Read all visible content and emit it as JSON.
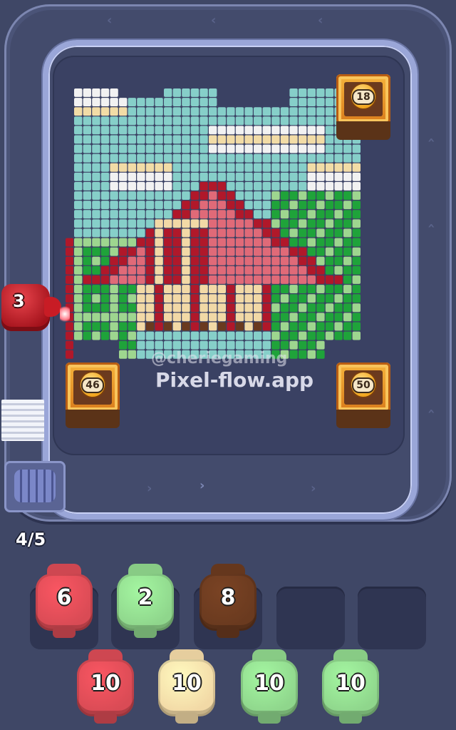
{
  "watermark": {
    "handle": "@cheriegaming",
    "site": "Pixel-flow.app"
  },
  "shooter": {
    "count": "3",
    "color": "#b3141d"
  },
  "queue_counter": "4/5",
  "crates": [
    {
      "name": "crate-top-right",
      "value": "18"
    },
    {
      "name": "crate-bottom-left",
      "value": "46"
    },
    {
      "name": "crate-bottom-right",
      "value": "50"
    }
  ],
  "slot_pigs": [
    {
      "count": "6",
      "color": "#d94b55"
    },
    {
      "count": "2",
      "color": "#8fd68c"
    },
    {
      "count": "8",
      "color": "#6a3a1f"
    }
  ],
  "queue_pigs": [
    {
      "count": "10",
      "color": "#d94b55"
    },
    {
      "count": "10",
      "color": "#f2d9a6"
    },
    {
      "count": "10",
      "color": "#8fd68c"
    },
    {
      "count": "10",
      "color": "#8fd68c"
    }
  ],
  "palette": {
    "sky": "#86cfc9",
    "cloud_white": "#f2f2f2",
    "cloud_cream": "#f2dca6",
    "roof_pink": "#e06a78",
    "roof_red": "#b0182a",
    "barn_cream": "#f2d9a6",
    "barn_brown": "#6a3a1f",
    "tree_green": "#1fa33a",
    "tree_light": "#9ed68f",
    "empty_teal": "#5f93a8"
  }
}
